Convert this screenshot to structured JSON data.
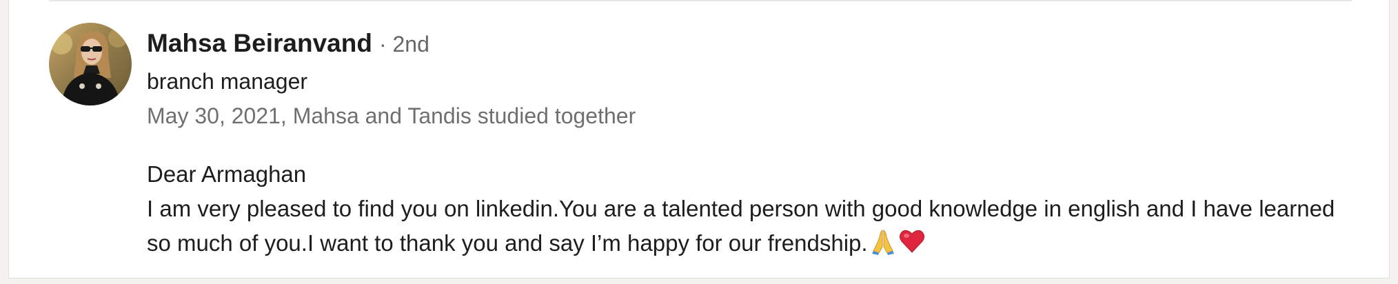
{
  "recommendation": {
    "author_name": "Mahsa Beiranvand",
    "connection_degree": "· 2nd",
    "headline": "branch manager",
    "meta": "May 30, 2021, Mahsa and Tandis studied together",
    "greeting": "Dear Armaghan",
    "body": "I am very pleased to find you on linkedin.You are a talented person with good knowledge in english and I have learned so much of you.I want to thank you and say I’m happy for our frendship.",
    "emojis": [
      "folded-hands-icon",
      "red-heart-icon"
    ]
  },
  "colors": {
    "text_primary": "#1d1d1d",
    "text_secondary": "#6f6f6f",
    "background": "#ffffff",
    "page_background": "#f3f2ef"
  }
}
